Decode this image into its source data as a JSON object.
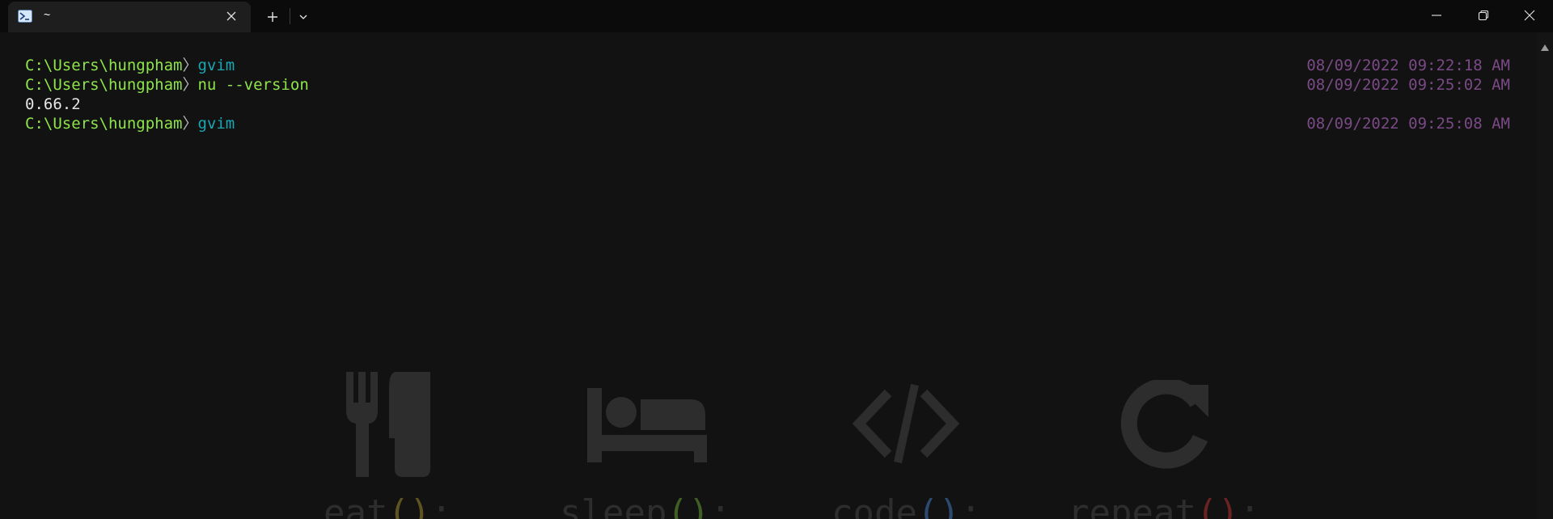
{
  "tab": {
    "icon": "powershell-icon",
    "title": "~",
    "close_icon": "close-icon"
  },
  "toolbar": {
    "new_tab_icon": "plus-icon",
    "dropdown_icon": "chevron-down-icon"
  },
  "window_controls": {
    "minimize_icon": "minimize-icon",
    "maximize_icon": "restore-icon",
    "close_icon": "close-icon"
  },
  "terminal": {
    "lines": [
      {
        "path": "C:\\Users\\hungpham",
        "sep": "〉",
        "command": "gvim",
        "timestamp": "08/09/2022 09:22:18 AM"
      },
      {
        "path": "C:\\Users\\hungpham",
        "sep": "〉",
        "command": "nu --version",
        "timestamp": "08/09/2022 09:25:02 AM"
      },
      {
        "output": "0.66.2"
      },
      {
        "path": "C:\\Users\\hungpham",
        "sep": "〉",
        "command": "gvim",
        "timestamp": "08/09/2022 09:25:08 AM"
      }
    ]
  },
  "background_art": {
    "items": [
      {
        "icon": "fork-knife-icon",
        "word": "eat",
        "paren": "()",
        "semi": ";",
        "paren_color": "#5e5420"
      },
      {
        "icon": "bed-icon",
        "word": "sleep",
        "paren": "()",
        "semi": ";",
        "paren_color": "#3f5f24"
      },
      {
        "icon": "code-icon",
        "word": "code",
        "paren": "()",
        "semi": ";",
        "paren_color": "#2b4a6e"
      },
      {
        "icon": "redo-icon",
        "word": "repeat",
        "paren": "()",
        "semi": ";",
        "paren_color": "#6a2222"
      }
    ],
    "art_color": "#2d2d2d"
  },
  "colors": {
    "prompt": "#8ee54b",
    "command_cyan": "#1ba6b3",
    "timestamp": "#7a4a86",
    "background": "#121212"
  },
  "scrollbar": {
    "up_arrow_icon": "arrow-up-icon"
  }
}
